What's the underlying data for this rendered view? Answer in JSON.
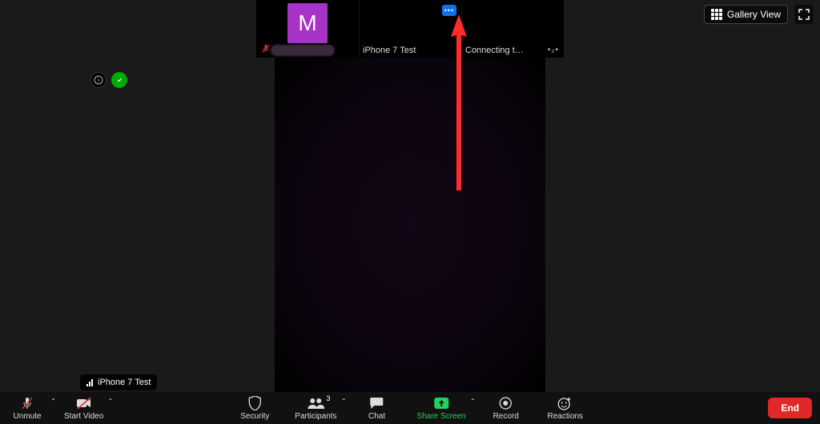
{
  "top": {
    "gallery_label": "Gallery View"
  },
  "participants": [
    {
      "name": "",
      "avatar_letter": "M",
      "muted": true,
      "redacted": true
    },
    {
      "name": "iPhone 7 Test",
      "show_more": true
    },
    {
      "name": "Connecting t…",
      "show_dots": true
    }
  ],
  "audio_source_tip": "iPhone 7 Test",
  "toolbar": {
    "unmute": "Unmute",
    "start_video": "Start Video",
    "security": "Security",
    "participants": "Participants",
    "participants_count": "3",
    "chat": "Chat",
    "share": "Share Screen",
    "record": "Record",
    "reactions": "Reactions",
    "end": "End"
  },
  "colors": {
    "accent_blue": "#0e72ed",
    "share_green": "#23d160",
    "end_red": "#e02828",
    "avatar_purple": "#a733c7"
  }
}
